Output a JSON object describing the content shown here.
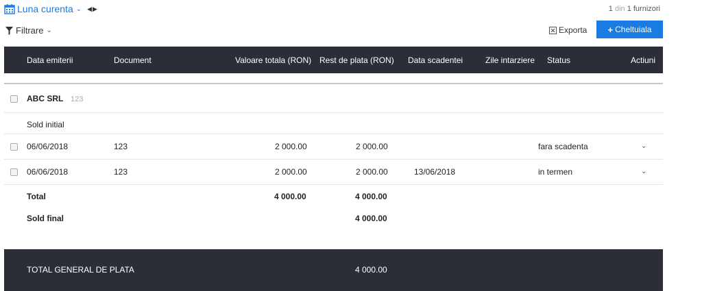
{
  "header": {
    "period_label": "Luna curenta",
    "counter": {
      "current": "1",
      "word": "din",
      "total": "1 furnizori"
    },
    "filter_label": "Filtrare",
    "export_label": "Exporta",
    "add_button_label": "Cheltuiala",
    "accent_color": "#1a7be0"
  },
  "table": {
    "columns": [
      "Data emiterii",
      "Document",
      "Valoare totala (RON)",
      "Rest de plata (RON)",
      "Data scadentei",
      "Zile intarziere",
      "Status",
      "Actiuni"
    ],
    "supplier": {
      "name": "ABC SRL",
      "code": "123"
    },
    "opening_label": "Sold initial",
    "rows": [
      {
        "date": "06/06/2018",
        "document": "123",
        "total": "2 000.00",
        "rest": "2 000.00",
        "due": "",
        "delay": "",
        "status": "fara scadenta"
      },
      {
        "date": "06/06/2018",
        "document": "123",
        "total": "2 000.00",
        "rest": "2 000.00",
        "due": "13/06/2018",
        "delay": "",
        "status": "in termen"
      }
    ],
    "total": {
      "label": "Total",
      "total": "4 000.00",
      "rest": "4 000.00"
    },
    "final": {
      "label": "Sold final",
      "rest": "4 000.00"
    },
    "grand_total": {
      "label": "TOTAL GENERAL DE PLATA",
      "value": "4 000.00"
    },
    "header_bg": "#2b2e36"
  }
}
